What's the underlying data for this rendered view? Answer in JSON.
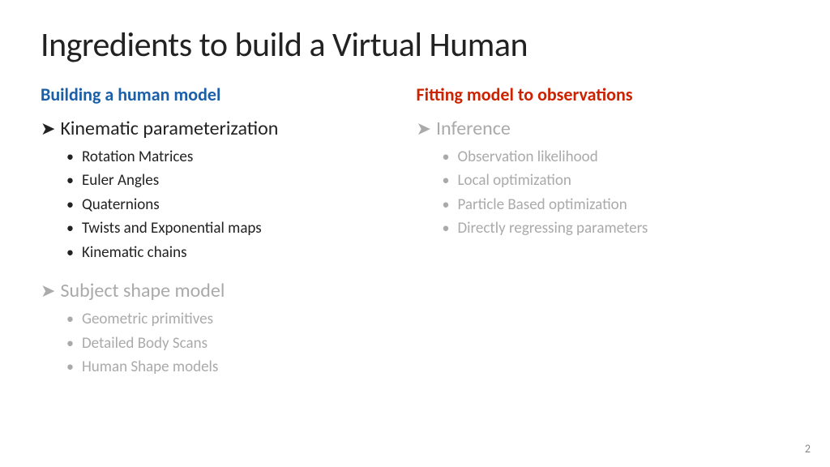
{
  "slide": {
    "title": "Ingredients to build a Virtual Human",
    "page_number": "2",
    "col_left": {
      "heading": "Building a human model",
      "section1": {
        "label": "Kinematic parameterization",
        "arrow": "➤",
        "active": true,
        "bullets": [
          "Rotation Matrices",
          "Euler Angles",
          "Quaternions",
          "Twists and Exponential maps",
          "Kinematic chains"
        ]
      },
      "section2": {
        "label": "Subject shape model",
        "arrow": "➤",
        "active": false,
        "bullets": [
          "Geometric primitives",
          "Detailed Body Scans",
          "Human Shape models"
        ]
      }
    },
    "col_right": {
      "heading": "Fitting model to observations",
      "section1": {
        "label": "Inference",
        "arrow": "➤",
        "active": false,
        "bullets": [
          "Observation likelihood",
          "Local optimization",
          "Particle Based optimization",
          "Directly regressing parameters"
        ]
      }
    }
  }
}
